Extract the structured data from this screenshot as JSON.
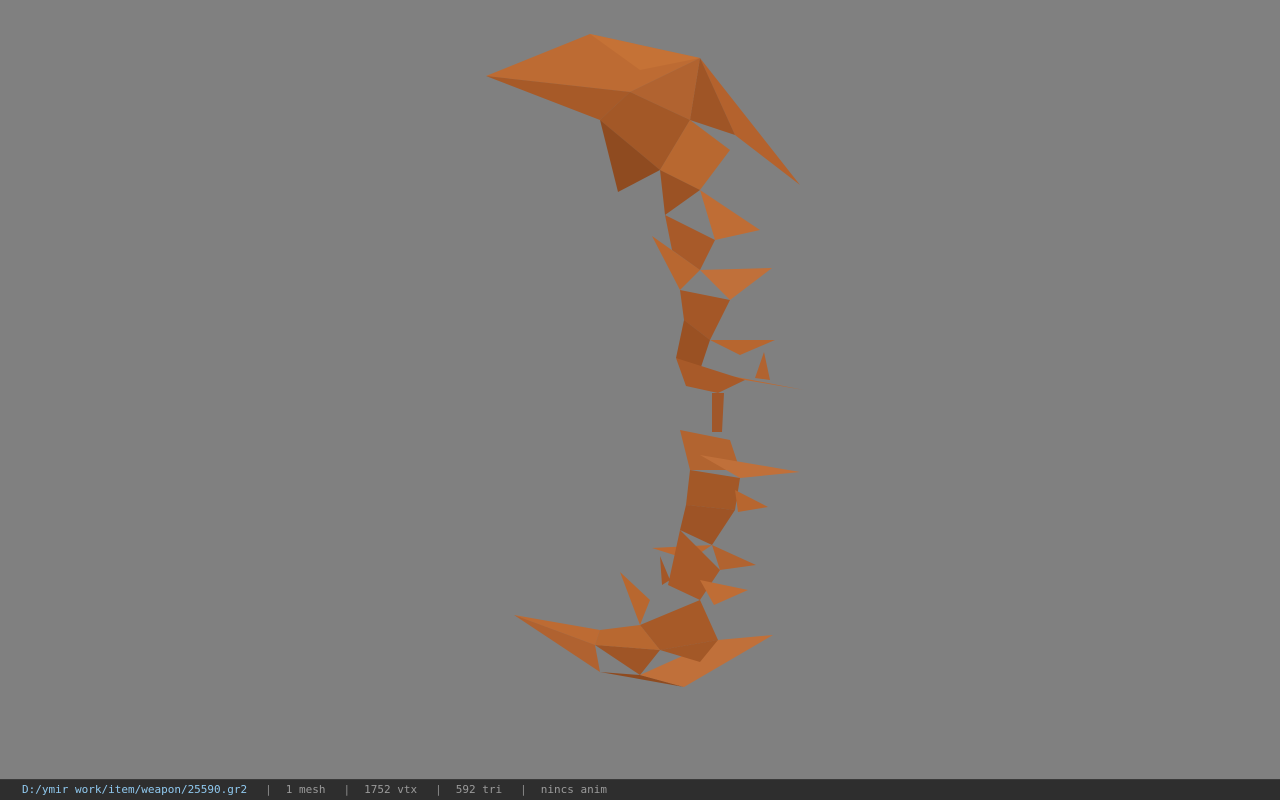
{
  "viewer": {
    "background_color": "#808080",
    "model_color": "#b4642e"
  },
  "status_bar": {
    "file_path": "D:/ymir work/item/weapon/25590.gr2",
    "mesh_count": "1 mesh",
    "vertex_count": "1752 vtx",
    "triangle_count": "592 tri",
    "anim_status": "nincs anim",
    "separator": "|"
  }
}
